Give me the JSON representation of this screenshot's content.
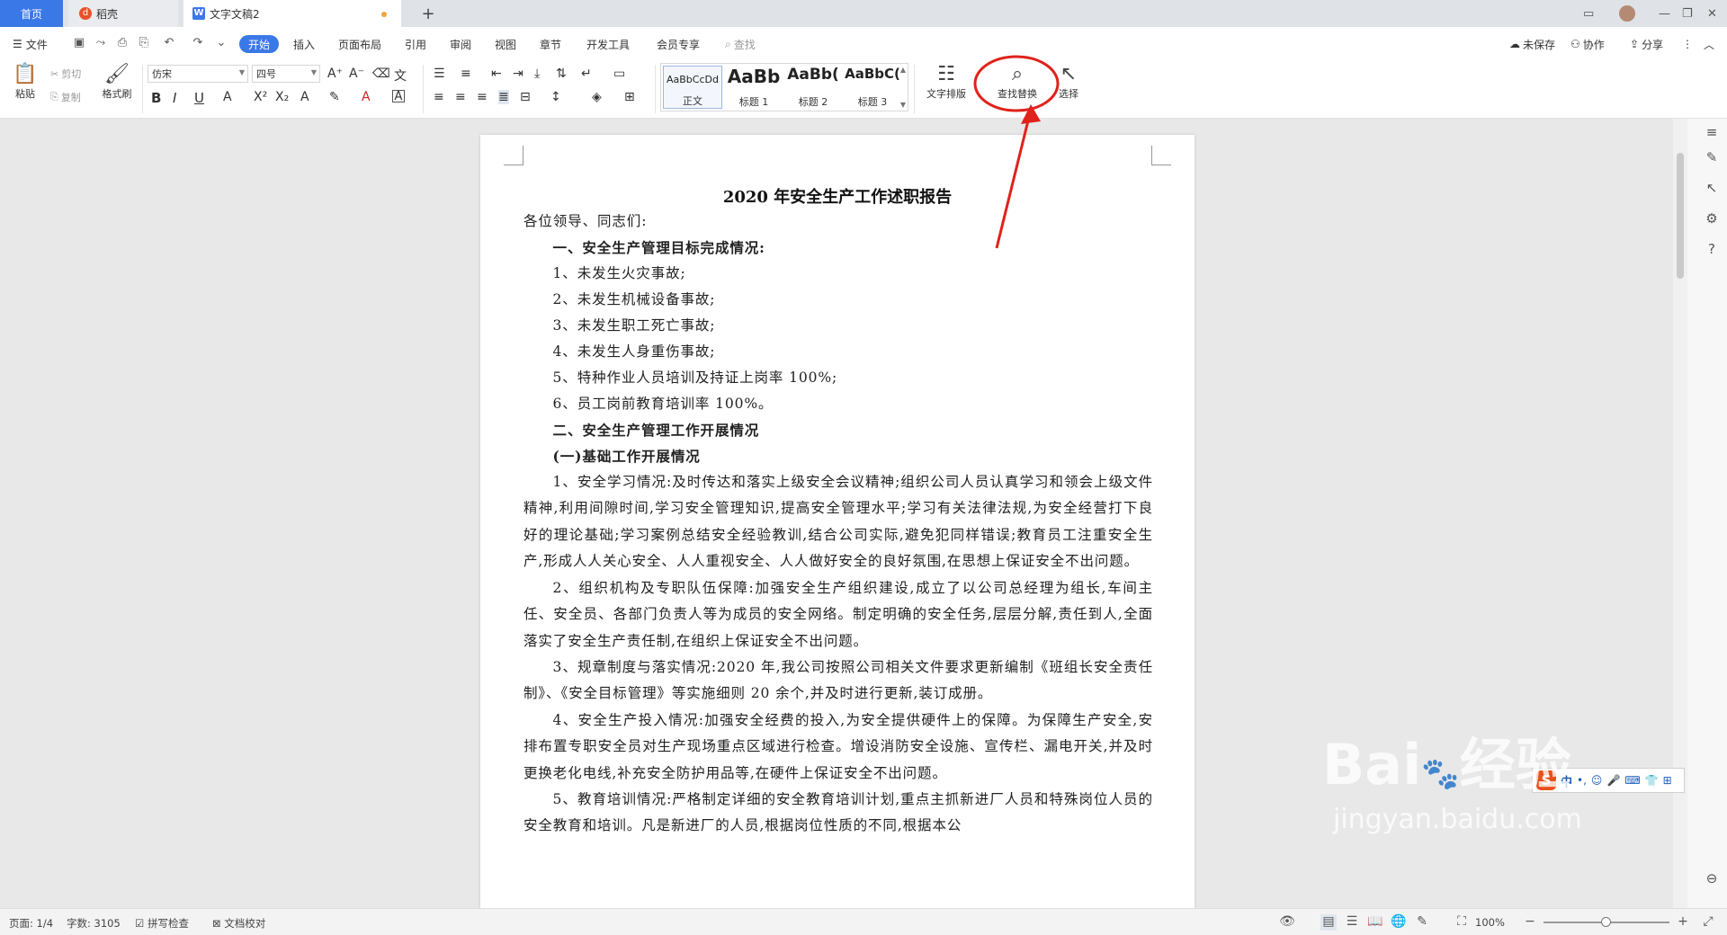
{
  "tabs": {
    "home": "首页",
    "daoke": "稻壳",
    "doc": "文字文稿2",
    "add": "+"
  },
  "menu": {
    "file": "文件",
    "items": [
      "开始",
      "插入",
      "页面布局",
      "引用",
      "审阅",
      "视图",
      "章节",
      "开发工具",
      "会员专享"
    ],
    "search": "查找",
    "unsaved": "未保存",
    "collab": "协作",
    "share": "分享"
  },
  "ribbon": {
    "paste": "粘贴",
    "cut": "剪切",
    "copy": "复制",
    "format_painter": "格式刷",
    "font": "仿宋",
    "size": "四号",
    "styles": [
      {
        "preview": "AaBbCcDd",
        "name": "正文"
      },
      {
        "preview": "AaBb",
        "name": "标题 1"
      },
      {
        "preview": "AaBb(",
        "name": "标题 2"
      },
      {
        "preview": "AaBbC(",
        "name": "标题 3"
      }
    ],
    "text_layout": "文字排版",
    "find_replace": "查找替换",
    "select": "选择"
  },
  "document": {
    "title": "2020 年安全生产工作述职报告",
    "paragraphs": [
      {
        "text": "各位领导、同志们:",
        "indent": 0,
        "bold": false
      },
      {
        "text": "一、安全生产管理目标完成情况:",
        "indent": 2,
        "bold": true
      },
      {
        "text": "1、未发生火灾事故;",
        "indent": 2,
        "bold": false
      },
      {
        "text": "2、未发生机械设备事故;",
        "indent": 2,
        "bold": false
      },
      {
        "text": "3、未发生职工死亡事故;",
        "indent": 2,
        "bold": false
      },
      {
        "text": "4、未发生人身重伤事故;",
        "indent": 2,
        "bold": false
      },
      {
        "text": "5、特种作业人员培训及持证上岗率 100%;",
        "indent": 2,
        "bold": false
      },
      {
        "text": "6、员工岗前教育培训率 100%。",
        "indent": 2,
        "bold": false
      },
      {
        "text": "二、安全生产管理工作开展情况",
        "indent": 2,
        "bold": true
      },
      {
        "text": "(一)基础工作开展情况",
        "indent": 2,
        "bold": true
      },
      {
        "text": "1、安全学习情况:及时传达和落实上级安全会议精神;组织公司人员认真学习和领会上级文件精神,利用间隙时间,学习安全管理知识,提高安全管理水平;学习有关法律法规,为安全经营打下良好的理论基础;学习案例总结安全经验教训,结合公司实际,避免犯同样错误;教育员工注重安全生产,形成人人关心安全、人人重视安全、人人做好安全的良好氛围,在思想上保证安全不出问题。",
        "indent": 2,
        "bold": false
      },
      {
        "text": "2、组织机构及专职队伍保障:加强安全生产组织建设,成立了以公司总经理为组长,车间主任、安全员、各部门负责人等为成员的安全网络。制定明确的安全任务,层层分解,责任到人,全面落实了安全生产责任制,在组织上保证安全不出问题。",
        "indent": 2,
        "bold": false
      },
      {
        "text": "3、规章制度与落实情况:2020 年,我公司按照公司相关文件要求更新编制《班组长安全责任制》、《安全目标管理》等实施细则 20 余个,并及时进行更新,装订成册。",
        "indent": 2,
        "bold": false
      },
      {
        "text": "4、安全生产投入情况:加强安全经费的投入,为安全提供硬件上的保障。为保障生产安全,安排布置专职安全员对生产现场重点区域进行检查。增设消防安全设施、宣传栏、漏电开关,并及时更换老化电线,补充安全防护用品等,在硬件上保证安全不出问题。",
        "indent": 2,
        "bold": false
      },
      {
        "text": "5、教育培训情况:严格制定详细的安全教育培训计划,重点主抓新进厂人员和特殊岗位人员的安全教育和培训。凡是新进厂的人员,根据岗位性质的不同,根据本公",
        "indent": 2,
        "bold": false
      }
    ]
  },
  "ime": {
    "mode": "中"
  },
  "status": {
    "page": "页面: 1/4",
    "words": "字数: 3105",
    "spell": "拼写检查",
    "proof": "文档校对",
    "zoom": "100%"
  },
  "watermark": {
    "brand": "Bai",
    "brand2": "经验",
    "url": "jingyan.baidu.com"
  },
  "colors": {
    "accent": "#3b78e7",
    "annotation": "#e0221b"
  }
}
